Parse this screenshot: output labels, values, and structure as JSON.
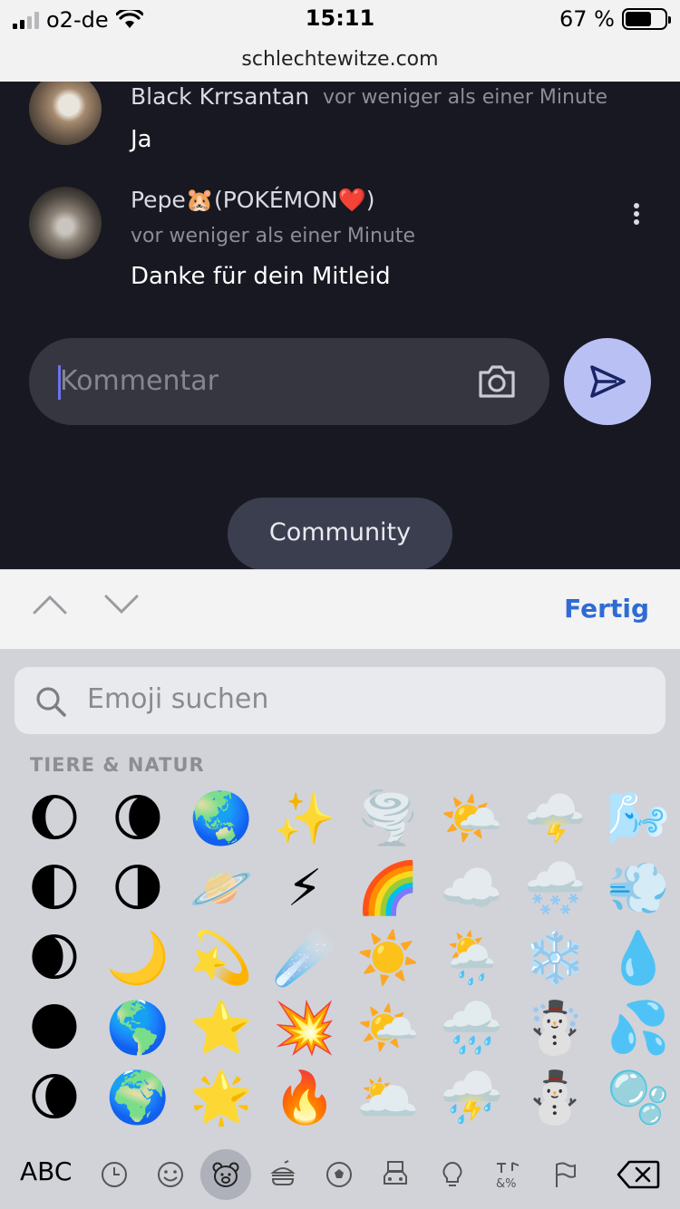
{
  "status_bar": {
    "carrier": "o2-de",
    "time": "15:11",
    "battery_percent": "67 %",
    "battery_level": 0.67
  },
  "url_bar": {
    "domain": "schlechtewitze.com"
  },
  "comments": [
    {
      "author": "Black Krrsantan",
      "timestamp": "vor weniger als einer Minute",
      "text": "Ja"
    },
    {
      "author": "Pepe🐹(POKÉMON❤️)",
      "timestamp": "vor weniger als einer Minute",
      "text": "Danke für dein Mitleid"
    }
  ],
  "comment_input": {
    "placeholder": "Kommentar"
  },
  "community_button": {
    "label": "Community"
  },
  "accessory": {
    "done_label": "Fertig"
  },
  "emoji_keyboard": {
    "search_placeholder": "Emoji suchen",
    "category_title": "TIERE & NATUR",
    "abc_label": "ABC",
    "emojis": [
      [
        "🌔",
        "🌘",
        "🌏",
        "✨",
        "🌪️",
        "🌤️",
        "🌩️",
        "🌬️"
      ],
      [
        "🌓",
        "🌗",
        "🪐",
        "⚡",
        "🌈",
        "☁️",
        "🌨️",
        "💨"
      ],
      [
        "🌒",
        "🌙",
        "💫",
        "☄️",
        "☀️",
        "🌦️",
        "❄️",
        "💧"
      ],
      [
        "🌑",
        "🌎",
        "⭐",
        "💥",
        "🌤️",
        "🌧️",
        "☃️",
        "💦"
      ],
      [
        "🌘",
        "🌍",
        "🌟",
        "🔥",
        "🌥️",
        "⛈️",
        "⛄",
        "🫧"
      ]
    ],
    "categories": [
      "clock-icon",
      "smiley-icon",
      "bear-icon",
      "food-icon",
      "ball-icon",
      "car-icon",
      "bulb-icon",
      "symbols-icon",
      "flag-icon"
    ],
    "active_category": "bear-icon"
  }
}
